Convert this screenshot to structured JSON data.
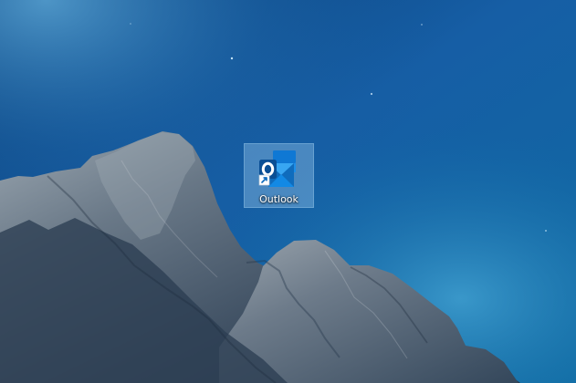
{
  "desktop": {
    "icons": [
      {
        "label": "Outlook",
        "icon": "outlook-app-icon",
        "shortcut_overlay": "shortcut-arrow-icon",
        "selected": true
      }
    ],
    "wallpaper": {
      "subject": "mountain-night-sky",
      "colors": {
        "sky_top": "#0a4a8b",
        "sky_mid": "#1b64ab",
        "sky_glow": "#3a9ad1",
        "rock_dark": "#26384b",
        "rock_light": "#8b98a5"
      }
    },
    "colors": {
      "selection": "#9fd0f0",
      "outlook_blue": "#0f6cbd",
      "outlook_dark": "#0a4f95",
      "label_text": "#ffffff"
    }
  }
}
